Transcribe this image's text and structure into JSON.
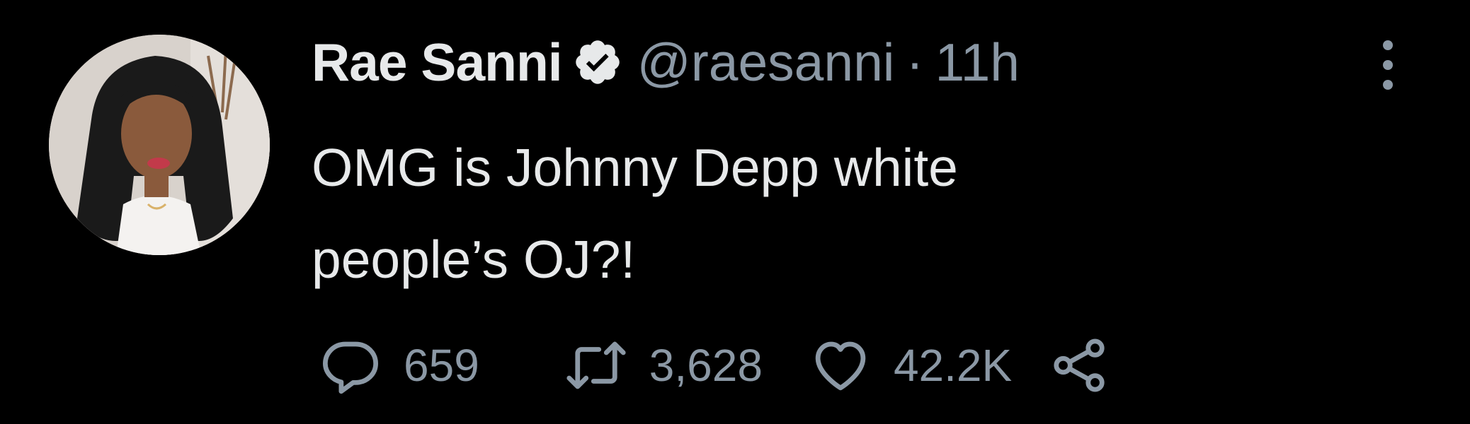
{
  "tweet": {
    "author_name": "Rae Sanni",
    "handle": "@raesanni",
    "separator": "·",
    "time": "11h",
    "verified": true,
    "text": "OMG is Johnny Depp white\npeople’s OJ?!",
    "actions": {
      "replies": "659",
      "retweets": "3,628",
      "likes": "42.2K"
    }
  },
  "icons": {
    "verified": "verified-badge-icon",
    "more": "more-options-icon",
    "reply": "reply-icon",
    "retweet": "retweet-icon",
    "like": "like-icon",
    "share": "share-icon"
  },
  "colors": {
    "background": "#000000",
    "primary_text": "#e7e9ea",
    "secondary_text": "#8b98a5"
  }
}
